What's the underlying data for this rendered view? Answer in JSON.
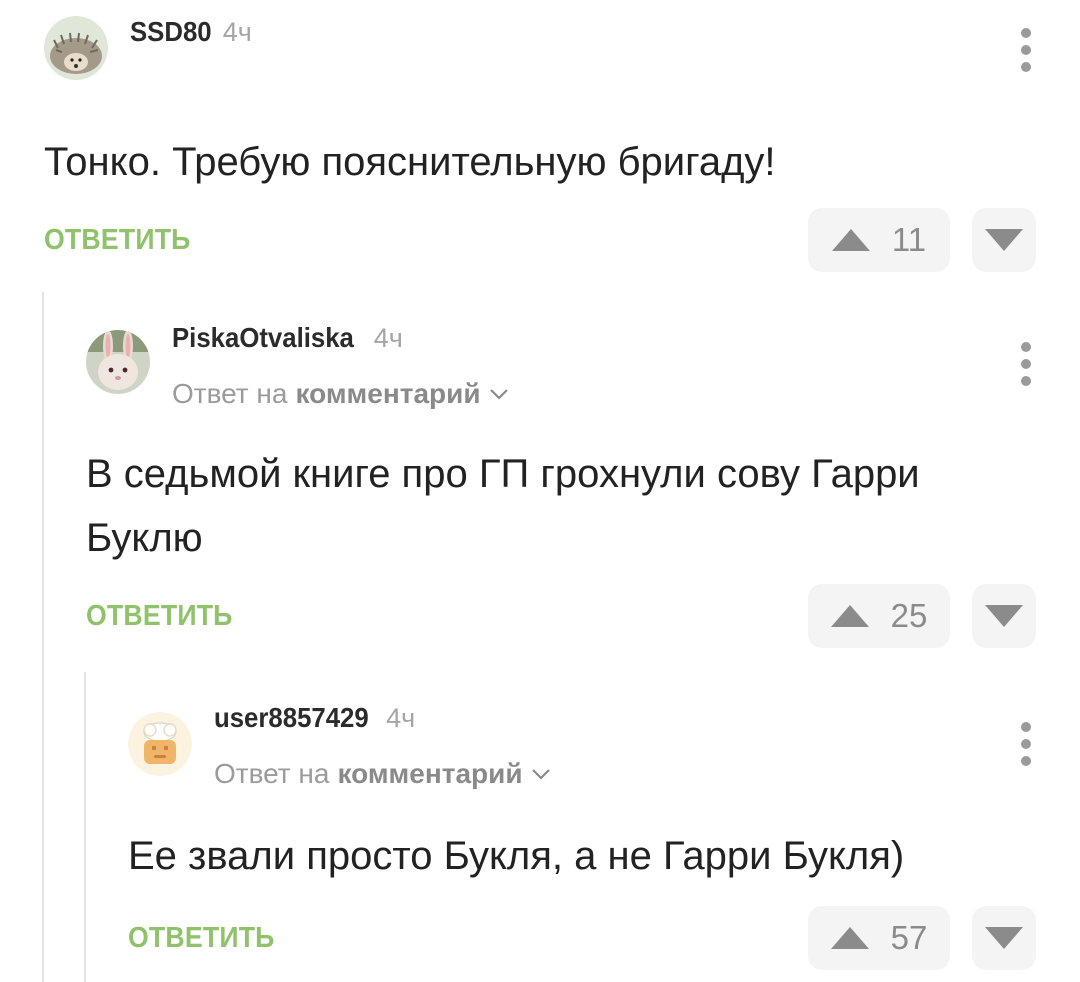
{
  "comments": [
    {
      "author": "SSD80",
      "time": "4ч",
      "reply_prefix": "",
      "reply_link": "",
      "text": "Тонко. Требую пояснительную бригаду!",
      "reply_label": "ОТВЕТИТЬ",
      "votes": "11"
    },
    {
      "author": "PiskaOtvaliska",
      "time": "4ч",
      "reply_prefix": "Ответ на",
      "reply_link": "комментарий",
      "text": "В седьмой книге про ГП грохнули сову Гарри Буклю",
      "reply_label": "ОТВЕТИТЬ",
      "votes": "25"
    },
    {
      "author": "user8857429",
      "time": "4ч",
      "reply_prefix": "Ответ на",
      "reply_link": "комментарий",
      "text": "Ее звали просто Букля, а не Гарри Букля)",
      "reply_label": "ОТВЕТИТЬ",
      "votes": "57"
    }
  ],
  "colors": {
    "accent": "#8fc26a",
    "muted": "#a5a5a5",
    "vote_bg": "#f4f4f4"
  },
  "icons": {
    "upvote": "triangle-up-icon",
    "downvote": "triangle-down-icon",
    "more": "vertical-dots-icon",
    "expand": "chevron-down-icon"
  }
}
